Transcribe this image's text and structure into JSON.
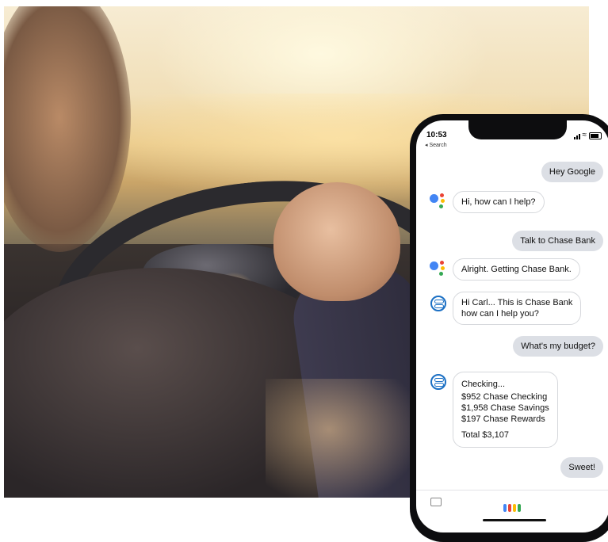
{
  "phone": {
    "status": {
      "time": "10:53",
      "back_label": "◂ Search"
    },
    "messages": [
      {
        "role": "user",
        "text": "Hey Google"
      },
      {
        "role": "assistant",
        "text": "Hi, how can I help?"
      },
      {
        "role": "user",
        "text": "Talk to Chase Bank"
      },
      {
        "role": "assistant",
        "text": "Alright. Getting Chase Bank."
      },
      {
        "role": "chase",
        "lines": [
          "Hi Carl... This is Chase Bank",
          "how can I help you?"
        ]
      },
      {
        "role": "user",
        "text": "What's my budget?"
      },
      {
        "role": "chase",
        "lines": [
          "Checking...",
          "$952 Chase Checking",
          "$1,958 Chase Savings",
          "$197 Chase Rewards",
          "Total $3,107"
        ]
      },
      {
        "role": "user",
        "text": "Sweet!"
      }
    ],
    "colors": {
      "google_blue": "#4285f4",
      "google_red": "#ea4335",
      "google_yellow": "#fbbc05",
      "google_green": "#34a853",
      "chase_blue": "#1a6fc4"
    }
  }
}
